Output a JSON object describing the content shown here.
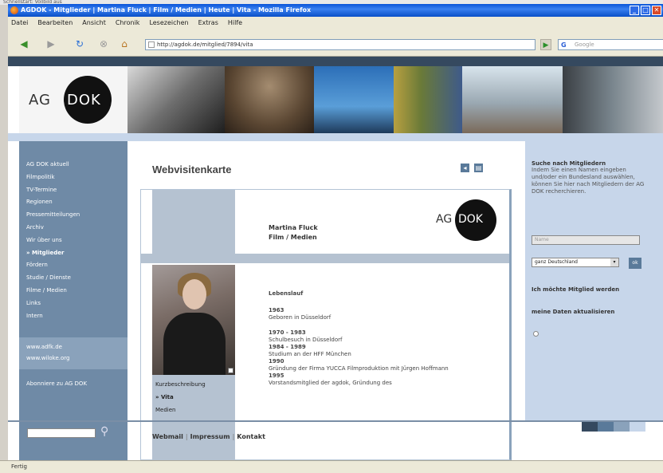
{
  "browser": {
    "desktop_text": "Schnellstart: Vollbild aus",
    "title": "AGDOK - Mitglieder | Martina Fluck | Film / Medien | Heute | Vita - Mozilla Firefox",
    "win_buttons": [
      "_",
      "□",
      "✕"
    ],
    "menu": [
      "Datei",
      "Bearbeiten",
      "Ansicht",
      "Chronik",
      "Lesezeichen",
      "Extras",
      "Hilfe"
    ],
    "url": "http://agdok.de/mitglied/7894/vita",
    "search_placeholder": "Google",
    "status": "Fertig"
  },
  "site": {
    "logo_ag": "AG",
    "logo_dok": "DOK",
    "nav": [
      "AG DOK aktuell",
      "Filmpolitik",
      "TV-Termine",
      "Regionen",
      "Pressemitteilungen",
      "Archiv",
      "Wir über uns",
      "» Mitglieder",
      "Fördern",
      "Studie / Dienste",
      "Filme / Medien",
      "Links",
      "Intern"
    ],
    "ext_links": [
      "www.adfk.de",
      "www.wiloke.org"
    ],
    "abo_link": "Abonniere zu AG DOK"
  },
  "main": {
    "title": "Webvisitenkarte",
    "icon_prev": "◂",
    "icon_print": "▤",
    "card": {
      "name": "Martina Fluck",
      "profession": "Film / Medien",
      "subnav": [
        "Kurzbeschreibung",
        "» Vita",
        "Medien"
      ],
      "bio_heading": "Lebenslauf",
      "bio": [
        {
          "year": "1963",
          "text": "Geboren in Düsseldorf"
        },
        {
          "year": "1970 - 1983",
          "text": "Schulbesuch in Düsseldorf"
        },
        {
          "year": "1984 - 1989",
          "text": "Studium an der HFF München"
        },
        {
          "year": "1990",
          "text": "Gründung der Firma YUCCA Filmproduktion mit Jürgen Hoffmann"
        },
        {
          "year": "1995",
          "text": "Vorstandsmitglied der agdok, Gründung des"
        }
      ]
    }
  },
  "sidebar": {
    "search_title": "Suche nach Mitgliedern",
    "search_text": "Indem Sie einen Namen eingeben und/oder ein Bundesland auswählen, können Sie hier nach Mitgliedern der AG DOK recherchieren.",
    "name_placeholder": "Name",
    "region_select": "ganz Deutschland",
    "go_label": "ok",
    "member_link": "Ich möchte Mitglied werden",
    "update_link": "meine Daten aktualisieren"
  },
  "footer": {
    "links": [
      "Webmail",
      "Impressum",
      "Kontakt"
    ]
  },
  "colors": {
    "nav_bg": "#6f8aa6",
    "light_band": "#c7d6ea",
    "top_band": "#35495f"
  }
}
